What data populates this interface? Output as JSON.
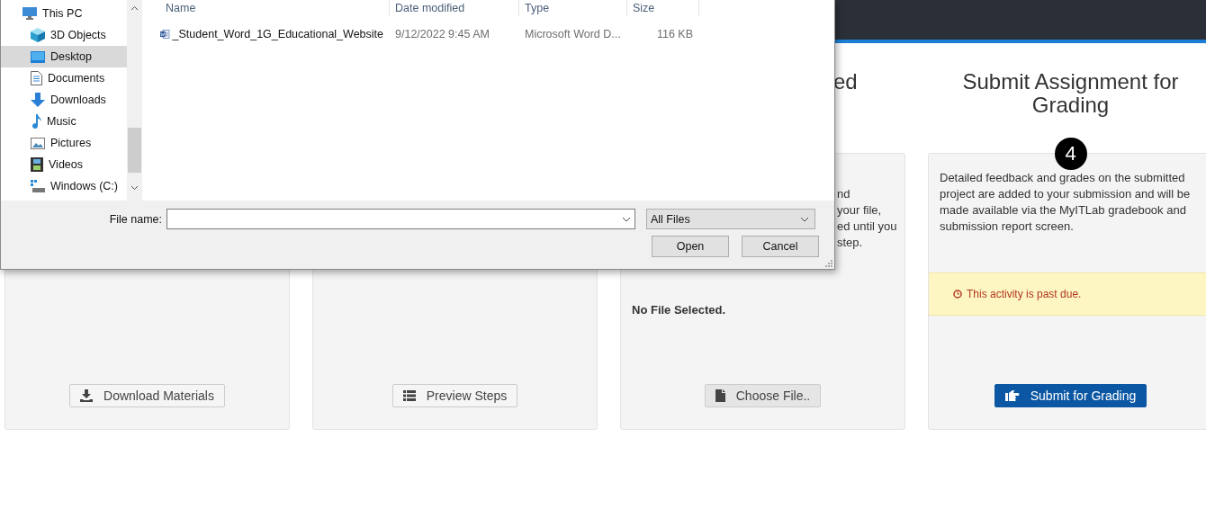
{
  "dialog": {
    "nav": [
      {
        "label": "This PC",
        "selected": false,
        "children": [
          {
            "label": "3D Objects",
            "selected": false
          },
          {
            "label": "Desktop",
            "selected": true
          },
          {
            "label": "Documents",
            "selected": false
          },
          {
            "label": "Downloads",
            "selected": false
          },
          {
            "label": "Music",
            "selected": false
          },
          {
            "label": "Pictures",
            "selected": false
          },
          {
            "label": "Videos",
            "selected": false
          },
          {
            "label": "Windows (C:)",
            "selected": false
          }
        ]
      }
    ],
    "file_columns": [
      "Name",
      "Date modified",
      "Type",
      "Size"
    ],
    "files": [
      {
        "name": "_Student_Word_1G_Educational_Website",
        "date_modified": "9/12/2022 9:45 AM",
        "type": "Microsoft Word D...",
        "size": "116 KB"
      }
    ],
    "file_name_label": "File name:",
    "file_type": "All Files",
    "buttons": [
      "Open",
      "Cancel"
    ]
  },
  "page": {
    "columns": [
      {
        "kind": "download",
        "button": {
          "label": "Download Materials",
          "kind": "default"
        }
      },
      {
        "kind": "preview",
        "button": {
          "label": "Preview Steps",
          "kind": "default"
        }
      },
      {
        "kind": "upload",
        "heading": "ed",
        "text_lines": [
          "nd",
          "your file,",
          "ed until you",
          "step."
        ],
        "status": "No File Selected.",
        "button": {
          "label": "Choose File..",
          "kind": "file"
        }
      },
      {
        "kind": "submit",
        "heading": "Submit Assignment for Grading",
        "step": "4",
        "text": "Detailed feedback and grades on the submitted project are added to your submission and will be made available via the MyITLab gradebook and submission report screen.",
        "alert": "This activity is past due.",
        "button": {
          "label": "Submit for Grading",
          "kind": "primary"
        }
      }
    ]
  }
}
